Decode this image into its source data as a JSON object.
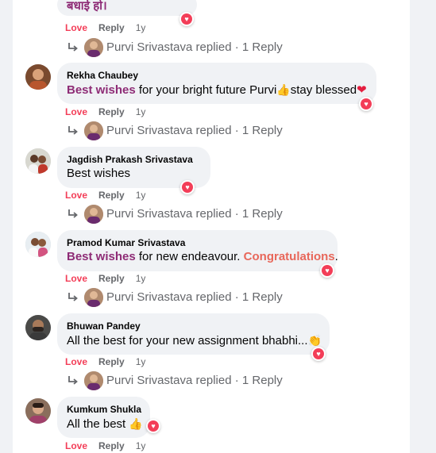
{
  "top_partial": {
    "text": "बधाई हो।",
    "love": "Love",
    "reply": "Reply",
    "time": "1y",
    "replied": "Purvi Srivastava replied · 1 Reply"
  },
  "comments": [
    {
      "author": "Rekha Chaubey",
      "text_highlight": "Best wishes",
      "text_rest": " for your bright future Purvi",
      "emoji_thumb": "👍",
      "text_after": "stay blessed",
      "emoji_heart": "❤",
      "love": "Love",
      "reply": "Reply",
      "time": "1y",
      "replied": "Purvi Srivastava replied · 1 Reply"
    },
    {
      "author": "Jagdish Prakash Srivastava",
      "text": "Best wishes",
      "love": "Love",
      "reply": "Reply",
      "time": "1y",
      "replied": "Purvi Srivastava replied · 1 Reply"
    },
    {
      "author": "Pramod Kumar Srivastava",
      "text_highlight": "Best wishes",
      "text_rest": " for new endeavour. ",
      "text_highlight2": "Congratulations",
      "text_end": ".",
      "love": "Love",
      "reply": "Reply",
      "time": "1y",
      "replied": "Purvi Srivastava replied · 1 Reply"
    },
    {
      "author": "Bhuwan Pandey",
      "text": "All the best for your new assignment bhabhi...",
      "emoji_clap": "👏",
      "love": "Love",
      "reply": "Reply",
      "time": "1y",
      "replied": "Purvi Srivastava replied · 1 Reply"
    },
    {
      "author": "Kumkum Shukla",
      "text": "All the best ",
      "emoji_thumb": "👍",
      "love": "Love",
      "reply": "Reply",
      "time": "1y"
    }
  ],
  "reaction_icon": "heart-reaction-icon",
  "colors": {
    "love": "#f33e58",
    "highlight_purple": "#8e2c76",
    "highlight_orange": "#e8675a",
    "muted": "#65676b"
  }
}
